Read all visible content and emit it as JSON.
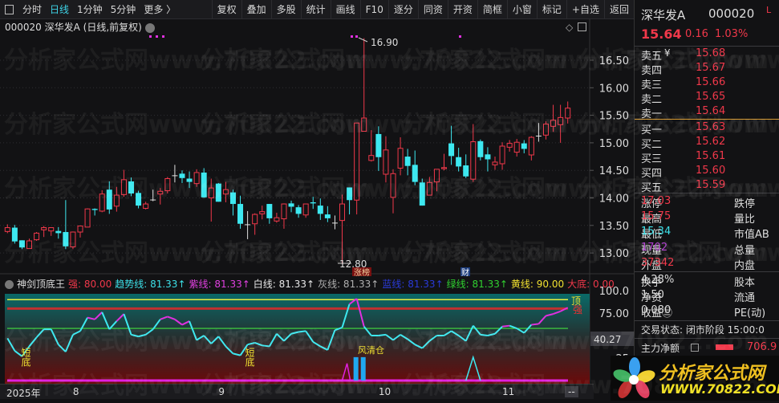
{
  "toolbar": {
    "left": [
      "分时",
      "日线",
      "1分钟",
      "5分钟",
      "更多 〉"
    ],
    "active": "日线",
    "right": [
      "复权",
      "叠加",
      "多股",
      "统计",
      "画线",
      "F10",
      "逐分",
      "同资",
      "开资",
      "简框",
      "小窗",
      "标记",
      "+自选",
      "返回"
    ]
  },
  "chart_title": "000020 深华发A (日线,前复权)",
  "chart_data": {
    "type": "candlestick",
    "ylim": [
      12.6,
      16.9
    ],
    "yticks": [
      "16.50",
      "16.00",
      "15.50",
      "15.00",
      "14.50",
      "14.00",
      "13.50",
      "13.00"
    ],
    "candles": [
      [
        13.39,
        13.52,
        13.36,
        13.46
      ],
      [
        13.46,
        13.51,
        13.17,
        13.21
      ],
      [
        13.23,
        13.23,
        13.07,
        13.1
      ],
      [
        13.08,
        13.26,
        13.08,
        13.22
      ],
      [
        13.24,
        13.38,
        13.22,
        13.36
      ],
      [
        13.42,
        13.49,
        13.29,
        13.46
      ],
      [
        13.4,
        13.46,
        13.31,
        13.46
      ],
      [
        13.4,
        13.47,
        13.26,
        13.36
      ],
      [
        13.38,
        13.96,
        13.07,
        13.12
      ],
      [
        13.11,
        13.39,
        13.07,
        13.38
      ],
      [
        13.38,
        13.49,
        13.28,
        13.49
      ],
      [
        13.47,
        13.81,
        13.47,
        13.8
      ],
      [
        13.8,
        13.81,
        13.68,
        13.78
      ],
      [
        13.76,
        14.14,
        13.74,
        14.07
      ],
      [
        14.15,
        14.3,
        13.71,
        13.79
      ],
      [
        13.85,
        14.2,
        13.75,
        14.05
      ],
      [
        14.06,
        14.51,
        14.02,
        14.33
      ],
      [
        14.3,
        14.37,
        14.03,
        14.08
      ],
      [
        14.09,
        14.13,
        13.81,
        13.86
      ],
      [
        13.81,
        13.93,
        13.79,
        13.89
      ],
      [
        13.97,
        14.15,
        13.94,
        13.97
      ],
      [
        14.07,
        14.18,
        13.88,
        14.12
      ],
      [
        14.13,
        14.38,
        14.08,
        14.35
      ],
      [
        14.41,
        14.6,
        14.28,
        14.41
      ],
      [
        14.44,
        14.5,
        14.27,
        14.36
      ],
      [
        14.35,
        14.48,
        14.18,
        14.29
      ],
      [
        14.26,
        14.52,
        14.2,
        14.46
      ],
      [
        14.46,
        14.54,
        14.0,
        14.01
      ],
      [
        14.0,
        14.35,
        13.57,
        14.18
      ],
      [
        14.26,
        14.27,
        13.93,
        13.93
      ],
      [
        14.07,
        14.29,
        13.92,
        14.15
      ],
      [
        14.1,
        14.15,
        13.68,
        13.89
      ],
      [
        13.89,
        14.04,
        13.44,
        13.53
      ],
      [
        13.52,
        13.76,
        13.25,
        13.52
      ],
      [
        13.53,
        13.72,
        13.33,
        13.7
      ],
      [
        13.71,
        13.86,
        13.61,
        13.75
      ],
      [
        13.89,
        13.89,
        13.53,
        13.63
      ],
      [
        13.58,
        13.73,
        13.55,
        13.64
      ],
      [
        13.62,
        13.9,
        13.44,
        13.89
      ],
      [
        13.9,
        13.95,
        13.74,
        13.84
      ],
      [
        13.83,
        13.87,
        13.64,
        13.71
      ],
      [
        13.69,
        13.89,
        13.64,
        13.89
      ],
      [
        13.92,
        14.02,
        13.8,
        13.9
      ],
      [
        13.86,
        13.99,
        13.6,
        13.71
      ],
      [
        13.7,
        13.85,
        13.56,
        13.63
      ],
      [
        13.55,
        13.68,
        13.43,
        13.55
      ],
      [
        13.59,
        14.06,
        12.8,
        13.89
      ],
      [
        14.19,
        14.19,
        13.7,
        13.96
      ],
      [
        13.96,
        15.36,
        13.7,
        15.36
      ],
      [
        15.21,
        16.9,
        15.21,
        15.45
      ],
      [
        14.68,
        15.23,
        14.66,
        14.77
      ],
      [
        15.16,
        15.3,
        14.49,
        14.74
      ],
      [
        14.43,
        15.12,
        14.28,
        14.87
      ],
      [
        14.01,
        14.52,
        13.72,
        14.44
      ],
      [
        14.54,
        15.1,
        14.41,
        14.9
      ],
      [
        14.75,
        14.89,
        14.41,
        14.58
      ],
      [
        14.6,
        14.86,
        14.23,
        14.29
      ],
      [
        14.28,
        14.35,
        13.86,
        13.86
      ],
      [
        14.05,
        14.38,
        14.05,
        14.28
      ],
      [
        14.29,
        14.52,
        14.12,
        14.52
      ],
      [
        14.53,
        14.8,
        14.5,
        14.55
      ],
      [
        14.99,
        15.31,
        14.6,
        14.76
      ],
      [
        14.74,
        14.91,
        14.48,
        14.57
      ],
      [
        14.59,
        14.79,
        14.36,
        14.39
      ],
      [
        14.34,
        15.34,
        14.29,
        15.02
      ],
      [
        15.03,
        15.06,
        14.68,
        14.74
      ],
      [
        14.79,
        14.92,
        14.48,
        14.7
      ],
      [
        14.6,
        14.75,
        14.51,
        14.65
      ],
      [
        14.62,
        15.01,
        14.51,
        14.94
      ],
      [
        14.92,
        15.05,
        14.84,
        14.99
      ],
      [
        14.83,
        15.07,
        14.75,
        15.01
      ],
      [
        14.99,
        15.05,
        14.81,
        14.89
      ],
      [
        14.78,
        15.12,
        14.68,
        15.1
      ],
      [
        15.13,
        15.36,
        15.02,
        15.13
      ],
      [
        15.14,
        15.39,
        15.06,
        15.34
      ],
      [
        15.3,
        15.69,
        15.2,
        15.41
      ],
      [
        15.33,
        15.69,
        15.0,
        15.46
      ],
      [
        15.45,
        15.75,
        15.35,
        15.63
      ]
    ],
    "candle_format": "open,high,low,close",
    "annotations": {
      "high_label": "16.90",
      "low_label": "12.80",
      "tag_rank": "涨榜",
      "tag_finance": "财"
    },
    "indicator": {
      "name": "神剑顶底王",
      "yticks": [
        "100.0",
        "75.00",
        "25"
      ],
      "cursor_value": "40.27",
      "ylim": [
        0,
        100
      ],
      "main_line": [
        47,
        33,
        27,
        38,
        48,
        57,
        57,
        40,
        32,
        51,
        55,
        70,
        68,
        76,
        57,
        66,
        74,
        51,
        49,
        51,
        57,
        68,
        71,
        68,
        62,
        66,
        45,
        50,
        41,
        49,
        38,
        30,
        28,
        40,
        42,
        39,
        38,
        52,
        44,
        52,
        54,
        55,
        43,
        38,
        34,
        56,
        59,
        85,
        91,
        60,
        50,
        50,
        51,
        45,
        51,
        46,
        40,
        36,
        44,
        50,
        50,
        55,
        50,
        44,
        61,
        51,
        50,
        52,
        60,
        61,
        58,
        53,
        62,
        63,
        72,
        74,
        77,
        81
      ],
      "yellow_level": 90,
      "red_level": 80,
      "green_level": 58,
      "magenta_spike": {
        "index": 47,
        "value": 19
      },
      "cyan_spike": {
        "index": 64,
        "value": 26
      },
      "blue_bars": [
        {
          "index": 48,
          "value": 26
        },
        {
          "index": 49,
          "value": 26
        }
      ],
      "labels": {
        "bottom1": "短底",
        "bottom2": "短底",
        "risk": "风清仓",
        "top": "顶",
        "strong": "强"
      },
      "header": [
        {
          "label": "强: 80.00",
          "color": "#f0384a"
        },
        {
          "label": "趋势线: 81.33↑",
          "color": "#3de0e8"
        },
        {
          "label": "紫线: 81.33↑",
          "color": "#e040e0"
        },
        {
          "label": "白线: 81.33↑",
          "color": "#e8e8e8"
        },
        {
          "label": "灰线: 81.33↑",
          "color": "#b0b0b0"
        },
        {
          "label": "蓝线: 81.33↑",
          "color": "#2a3ad8"
        },
        {
          "label": "绿线: 81.33↑",
          "color": "#30d030"
        },
        {
          "label": "黄线: 90.00",
          "color": "#f0e030"
        },
        {
          "label": "大底: 0.00",
          "color": "#f0384a"
        }
      ]
    },
    "x_labels": [
      {
        "label": "2025年",
        "index": 0
      },
      {
        "label": "8",
        "index": 9
      },
      {
        "label": "9",
        "index": 29
      },
      {
        "label": "10",
        "index": 51
      },
      {
        "label": "11",
        "index": 68
      }
    ],
    "x_end": "--"
  },
  "quote": {
    "name": "深华发A",
    "code": "000020",
    "flag": "L",
    "price": "15.64",
    "change": "0.16",
    "pct": "1.03%",
    "sell": [
      {
        "l": "卖五",
        "v": "15.68"
      },
      {
        "l": "卖四",
        "v": "15.67"
      },
      {
        "l": "卖三",
        "v": "15.66"
      },
      {
        "l": "卖二",
        "v": "15.65"
      },
      {
        "l": "卖一",
        "v": "15.64"
      }
    ],
    "sell_icon": "¥",
    "buy": [
      {
        "l": "买一",
        "v": "15.63"
      },
      {
        "l": "买二",
        "v": "15.62"
      },
      {
        "l": "买三",
        "v": "15.61"
      },
      {
        "l": "买四",
        "v": "15.60"
      },
      {
        "l": "买五",
        "v": "15.59"
      }
    ],
    "stats": [
      {
        "l": "涨停",
        "v": "17.03",
        "c": "red",
        "r": "跌停"
      },
      {
        "l": "最高",
        "v": "15.75",
        "c": "red",
        "r": "量比"
      },
      {
        "l": "最低",
        "v": "15.34",
        "c": "cyan",
        "r": "市值AB"
      },
      {
        "l": "现量",
        "v": "1702",
        "c": "purple",
        "r": "总量"
      },
      {
        "l": "外盘",
        "v": "37342",
        "c": "red",
        "r": "内盘"
      }
    ],
    "stats2": [
      {
        "l": "换手",
        "v": "4.28%",
        "r": "股本"
      },
      {
        "l": "净资",
        "v": "1.50",
        "r": "流通"
      },
      {
        "l": "收益㊂",
        "v": "0.080",
        "r": "PE(动)"
      }
    ],
    "trade_status": "交易状态: 闭市阶段 15:00:0",
    "main_net_label": "主力净额",
    "main_net_value": "706.9"
  },
  "watermark": "分析家公式网www.70822.com",
  "logo": {
    "cn": "分析家公式网",
    "url": "WWW.70822.COM"
  }
}
